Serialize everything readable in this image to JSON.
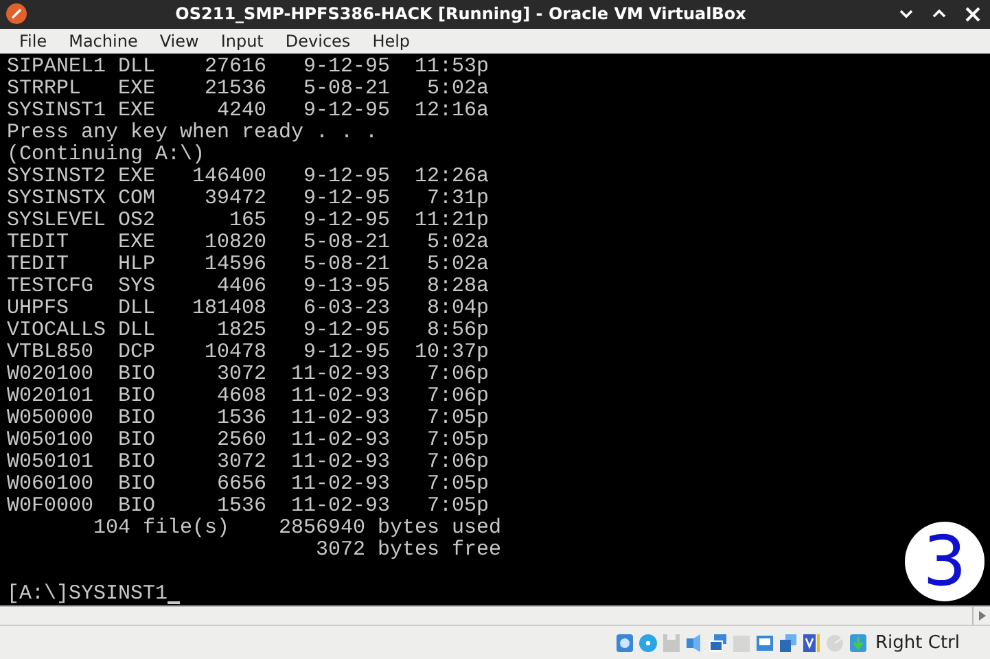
{
  "window": {
    "title": "OS211_SMP-HPFS386-HACK [Running] - Oracle VM VirtualBox"
  },
  "menu": [
    "File",
    "Machine",
    "View",
    "Input",
    "Devices",
    "Help"
  ],
  "console": [
    {
      "kind": "entry",
      "name": "SIPANEL1",
      "ext": "DLL",
      "size": "27616",
      "date": "9-12-95",
      "time": "11:53p"
    },
    {
      "kind": "entry",
      "name": "STRRPL",
      "ext": "EXE",
      "size": "21536",
      "date": "5-08-21",
      "time": "5:02a"
    },
    {
      "kind": "entry",
      "name": "SYSINST1",
      "ext": "EXE",
      "size": "4240",
      "date": "9-12-95",
      "time": "12:16a"
    },
    {
      "kind": "text",
      "text": "Press any key when ready . . ."
    },
    {
      "kind": "text",
      "text": "(Continuing A:\\)"
    },
    {
      "kind": "entry",
      "name": "SYSINST2",
      "ext": "EXE",
      "size": "146400",
      "date": "9-12-95",
      "time": "12:26a"
    },
    {
      "kind": "entry",
      "name": "SYSINSTX",
      "ext": "COM",
      "size": "39472",
      "date": "9-12-95",
      "time": "7:31p"
    },
    {
      "kind": "entry",
      "name": "SYSLEVEL",
      "ext": "OS2",
      "size": "165",
      "date": "9-12-95",
      "time": "11:21p"
    },
    {
      "kind": "entry",
      "name": "TEDIT",
      "ext": "EXE",
      "size": "10820",
      "date": "5-08-21",
      "time": "5:02a"
    },
    {
      "kind": "entry",
      "name": "TEDIT",
      "ext": "HLP",
      "size": "14596",
      "date": "5-08-21",
      "time": "5:02a"
    },
    {
      "kind": "entry",
      "name": "TESTCFG",
      "ext": "SYS",
      "size": "4406",
      "date": "9-13-95",
      "time": "8:28a"
    },
    {
      "kind": "entry",
      "name": "UHPFS",
      "ext": "DLL",
      "size": "181408",
      "date": "6-03-23",
      "time": "8:04p"
    },
    {
      "kind": "entry",
      "name": "VIOCALLS",
      "ext": "DLL",
      "size": "1825",
      "date": "9-12-95",
      "time": "8:56p"
    },
    {
      "kind": "entry",
      "name": "VTBL850",
      "ext": "DCP",
      "size": "10478",
      "date": "9-12-95",
      "time": "10:37p"
    },
    {
      "kind": "entry",
      "name": "W020100",
      "ext": "BIO",
      "size": "3072",
      "date": "11-02-93",
      "time": "7:06p"
    },
    {
      "kind": "entry",
      "name": "W020101",
      "ext": "BIO",
      "size": "4608",
      "date": "11-02-93",
      "time": "7:06p"
    },
    {
      "kind": "entry",
      "name": "W050000",
      "ext": "BIO",
      "size": "1536",
      "date": "11-02-93",
      "time": "7:05p"
    },
    {
      "kind": "entry",
      "name": "W050100",
      "ext": "BIO",
      "size": "2560",
      "date": "11-02-93",
      "time": "7:05p"
    },
    {
      "kind": "entry",
      "name": "W050101",
      "ext": "BIO",
      "size": "3072",
      "date": "11-02-93",
      "time": "7:06p"
    },
    {
      "kind": "entry",
      "name": "W060100",
      "ext": "BIO",
      "size": "6656",
      "date": "11-02-93",
      "time": "7:05p"
    },
    {
      "kind": "entry",
      "name": "W0F0000",
      "ext": "BIO",
      "size": "1536",
      "date": "11-02-93",
      "time": "7:05p"
    },
    {
      "kind": "summary",
      "files": "104 file(s)",
      "used": "2856940 bytes used"
    },
    {
      "kind": "free",
      "text": "3072 bytes free"
    },
    {
      "kind": "blank"
    },
    {
      "kind": "prompt",
      "prompt": "[A:\\]",
      "input": "SYSINST1"
    }
  ],
  "badge": "3",
  "status_bar": {
    "host_key": "Right Ctrl"
  }
}
